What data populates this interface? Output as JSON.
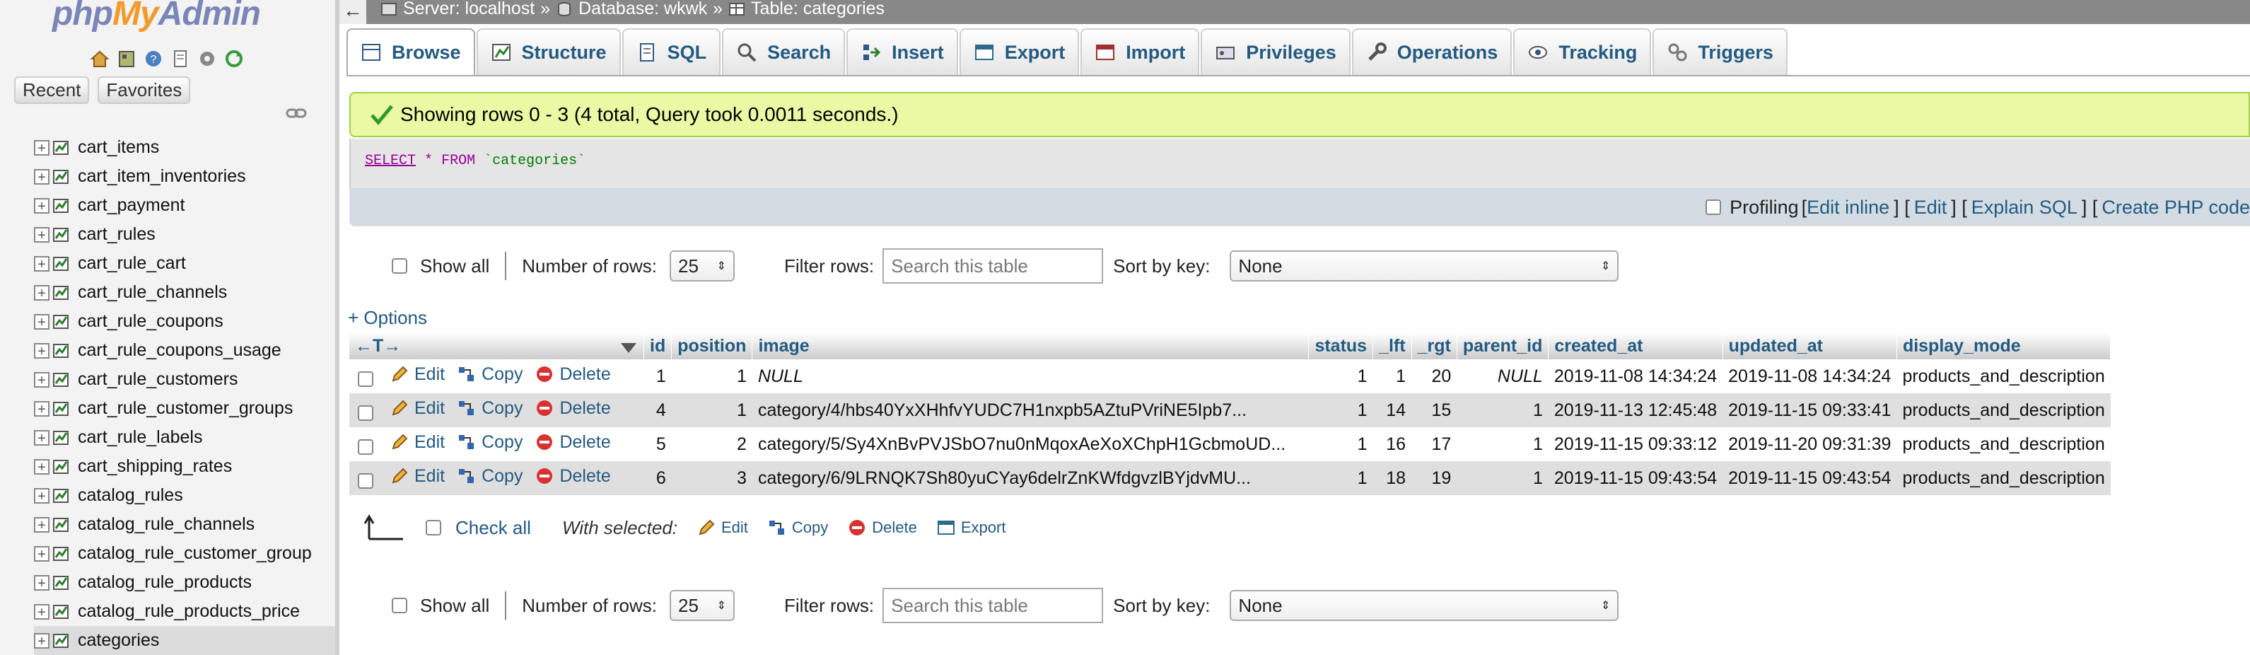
{
  "leftnav": {
    "logo": {
      "part1": "php",
      "part2": "My",
      "part3": "Admin"
    },
    "icons": [
      "home-icon",
      "database-icon",
      "help-icon",
      "docs-icon",
      "settings-icon",
      "reload-icon"
    ],
    "tabs": {
      "recent": "Recent",
      "favorites": "Favorites"
    },
    "tables": [
      {
        "name": "cart_items"
      },
      {
        "name": "cart_item_inventories"
      },
      {
        "name": "cart_payment"
      },
      {
        "name": "cart_rules"
      },
      {
        "name": "cart_rule_cart"
      },
      {
        "name": "cart_rule_channels"
      },
      {
        "name": "cart_rule_coupons"
      },
      {
        "name": "cart_rule_coupons_usage"
      },
      {
        "name": "cart_rule_customers"
      },
      {
        "name": "cart_rule_customer_groups"
      },
      {
        "name": "cart_rule_labels"
      },
      {
        "name": "cart_shipping_rates"
      },
      {
        "name": "catalog_rules"
      },
      {
        "name": "catalog_rule_channels"
      },
      {
        "name": "catalog_rule_customer_group"
      },
      {
        "name": "catalog_rule_products"
      },
      {
        "name": "catalog_rule_products_price"
      },
      {
        "name": "categories"
      }
    ]
  },
  "topbar": {
    "back": "←",
    "server": "Server: localhost",
    "sep1": "»",
    "database": "Database: wkwk",
    "sep2": "»",
    "table": "Table: categories"
  },
  "tabs": [
    {
      "label": "Browse",
      "icon": "browse-icon"
    },
    {
      "label": "Structure",
      "icon": "structure-icon"
    },
    {
      "label": "SQL",
      "icon": "sql-icon"
    },
    {
      "label": "Search",
      "icon": "search-icon"
    },
    {
      "label": "Insert",
      "icon": "insert-icon"
    },
    {
      "label": "Export",
      "icon": "export-icon"
    },
    {
      "label": "Import",
      "icon": "import-icon"
    },
    {
      "label": "Privileges",
      "icon": "privileges-icon"
    },
    {
      "label": "Operations",
      "icon": "operations-icon"
    },
    {
      "label": "Tracking",
      "icon": "tracking-icon"
    },
    {
      "label": "Triggers",
      "icon": "triggers-icon"
    }
  ],
  "message": {
    "text": "Showing rows 0 - 3 (4 total, Query took 0.0011 seconds.)"
  },
  "sql": {
    "select": "SELECT",
    "star": "*",
    "from": "FROM",
    "table": "`categories`"
  },
  "sqlfoot": {
    "profiling": "Profiling",
    "open1": "[",
    "edit_inline": "Edit inline",
    "close1": "] [",
    "edit": "Edit",
    "close2": "] [",
    "explain": "Explain SQL",
    "close3": "] [",
    "create_php": "Create PHP code"
  },
  "nav": {
    "show_all": "Show all",
    "rows_label": "Number of rows:",
    "rows_value": "25",
    "filter_label": "Filter rows:",
    "filter_placeholder": "Search this table",
    "sort_label": "Sort by key:",
    "sort_value": "None"
  },
  "options": "+ Options",
  "table": {
    "arrows": "←T→",
    "columns": [
      "id",
      "position",
      "image",
      "status",
      "_lft",
      "_rgt",
      "parent_id",
      "created_at",
      "updated_at",
      "display_mode"
    ],
    "actions": {
      "edit": "Edit",
      "copy": "Copy",
      "delete": "Delete"
    },
    "rows": [
      {
        "id": "1",
        "position": "1",
        "image": "NULL",
        "status": "1",
        "lft": "1",
        "rgt": "20",
        "parent_id": "NULL",
        "created_at": "2019-11-08 14:34:24",
        "updated_at": "2019-11-08 14:34:24",
        "display_mode": "products_and_description"
      },
      {
        "id": "4",
        "position": "1",
        "image": "category/4/hbs40YxXHhfvYUDC7H1nxpb5AZtuPVriNE5Ipb7...",
        "status": "1",
        "lft": "14",
        "rgt": "15",
        "parent_id": "1",
        "created_at": "2019-11-13 12:45:48",
        "updated_at": "2019-11-15 09:33:41",
        "display_mode": "products_and_description"
      },
      {
        "id": "5",
        "position": "2",
        "image": "category/5/Sy4XnBvPVJSbO7nu0nMqoxAeXoXChpH1GcbmoUD...",
        "status": "1",
        "lft": "16",
        "rgt": "17",
        "parent_id": "1",
        "created_at": "2019-11-15 09:33:12",
        "updated_at": "2019-11-20 09:31:39",
        "display_mode": "products_and_description"
      },
      {
        "id": "6",
        "position": "3",
        "image": "category/6/9LRNQK7Sh80yuCYay6delrZnKWfdgvzlBYjdvMU...",
        "status": "1",
        "lft": "18",
        "rgt": "19",
        "parent_id": "1",
        "created_at": "2019-11-15 09:43:54",
        "updated_at": "2019-11-15 09:43:54",
        "display_mode": "products_and_description"
      }
    ]
  },
  "bulk": {
    "check_all": "Check all",
    "with_selected": "With selected:",
    "edit": "Edit",
    "copy": "Copy",
    "delete": "Delete",
    "export": "Export"
  }
}
